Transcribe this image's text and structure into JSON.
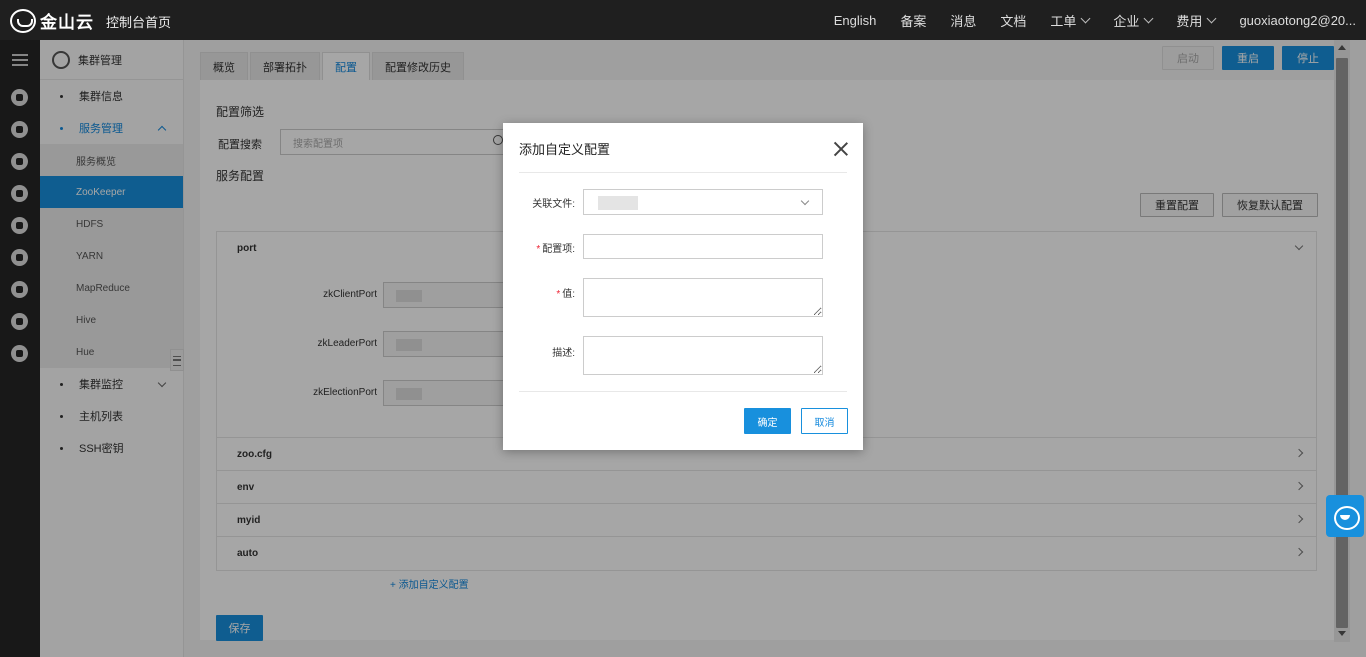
{
  "topbar": {
    "logo_text": "金山云",
    "console_link": "控制台首页",
    "nav": [
      {
        "label": "English",
        "dropdown": false
      },
      {
        "label": "备案",
        "dropdown": false
      },
      {
        "label": "消息",
        "dropdown": false
      },
      {
        "label": "文档",
        "dropdown": false
      },
      {
        "label": "工单",
        "dropdown": true
      },
      {
        "label": "企业",
        "dropdown": true
      },
      {
        "label": "费用",
        "dropdown": true
      },
      {
        "label": "guoxiaotong2@20...",
        "dropdown": false
      }
    ]
  },
  "sidebar": {
    "header": "集群管理",
    "items": [
      {
        "label": "集群信息"
      },
      {
        "label": "服务管理"
      },
      {
        "label": "集群监控"
      },
      {
        "label": "主机列表"
      },
      {
        "label": "SSH密钥"
      }
    ],
    "sub_items": [
      "服务概览",
      "ZooKeeper",
      "HDFS",
      "YARN",
      "MapReduce",
      "Hive",
      "Hue"
    ]
  },
  "main": {
    "tabs": [
      "概览",
      "部署拓扑",
      "配置",
      "配置修改历史"
    ],
    "actions": {
      "start": "启动",
      "restart": "重启",
      "stop": "停止"
    },
    "filter_title": "配置筛选",
    "search_label": "配置搜索",
    "search_placeholder": "搜索配置项",
    "service_config_title": "服务配置",
    "reset_button": "重置配置",
    "restore_default_button": "恢复默认配置",
    "groups": [
      "port",
      "zoo.cfg",
      "env",
      "myid",
      "auto"
    ],
    "port_fields": [
      "zkClientPort",
      "zkLeaderPort",
      "zkElectionPort"
    ],
    "add_custom_link": "+ 添加自定义配置",
    "save_button": "保存"
  },
  "dialog": {
    "title": "添加自定义配置",
    "file_label": "关联文件:",
    "key_label": "配置项:",
    "value_label": "值:",
    "desc_label": "描述:",
    "required_mark": "*",
    "confirm_button": "确定",
    "cancel_button": "取消"
  }
}
